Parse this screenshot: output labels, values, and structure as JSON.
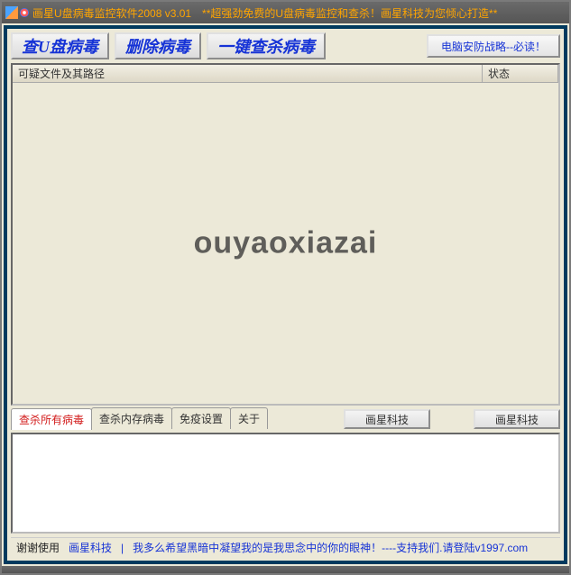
{
  "titlebar": {
    "text": "画星U盘病毒监控软件2008 v3.01　**超强劲免费的U盘病毒监控和查杀！画星科技为您倾心打造**"
  },
  "toolbar": {
    "scan_usb": "查U盘病毒",
    "delete_virus": "删除病毒",
    "one_click": "一键查杀病毒",
    "guide": "电脑安防战略--必读！"
  },
  "list": {
    "col_path": "可疑文件及其路径",
    "col_status": "状态"
  },
  "watermark": "ouyaoxiazai",
  "tabs": {
    "items": [
      {
        "label": "查杀所有病毒",
        "active": true
      },
      {
        "label": "查杀内存病毒",
        "active": false
      },
      {
        "label": "免疫设置",
        "active": false
      },
      {
        "label": "关于",
        "active": false
      }
    ],
    "btn1": "画星科技",
    "btn2": "画星科技"
  },
  "status": {
    "thanks": "谢谢使用",
    "company": "画星科技",
    "divider": "|",
    "message": "我多么希望黑暗中凝望我的是我思念中的你的眼神！----支持我们.请登陆v1997.com"
  }
}
